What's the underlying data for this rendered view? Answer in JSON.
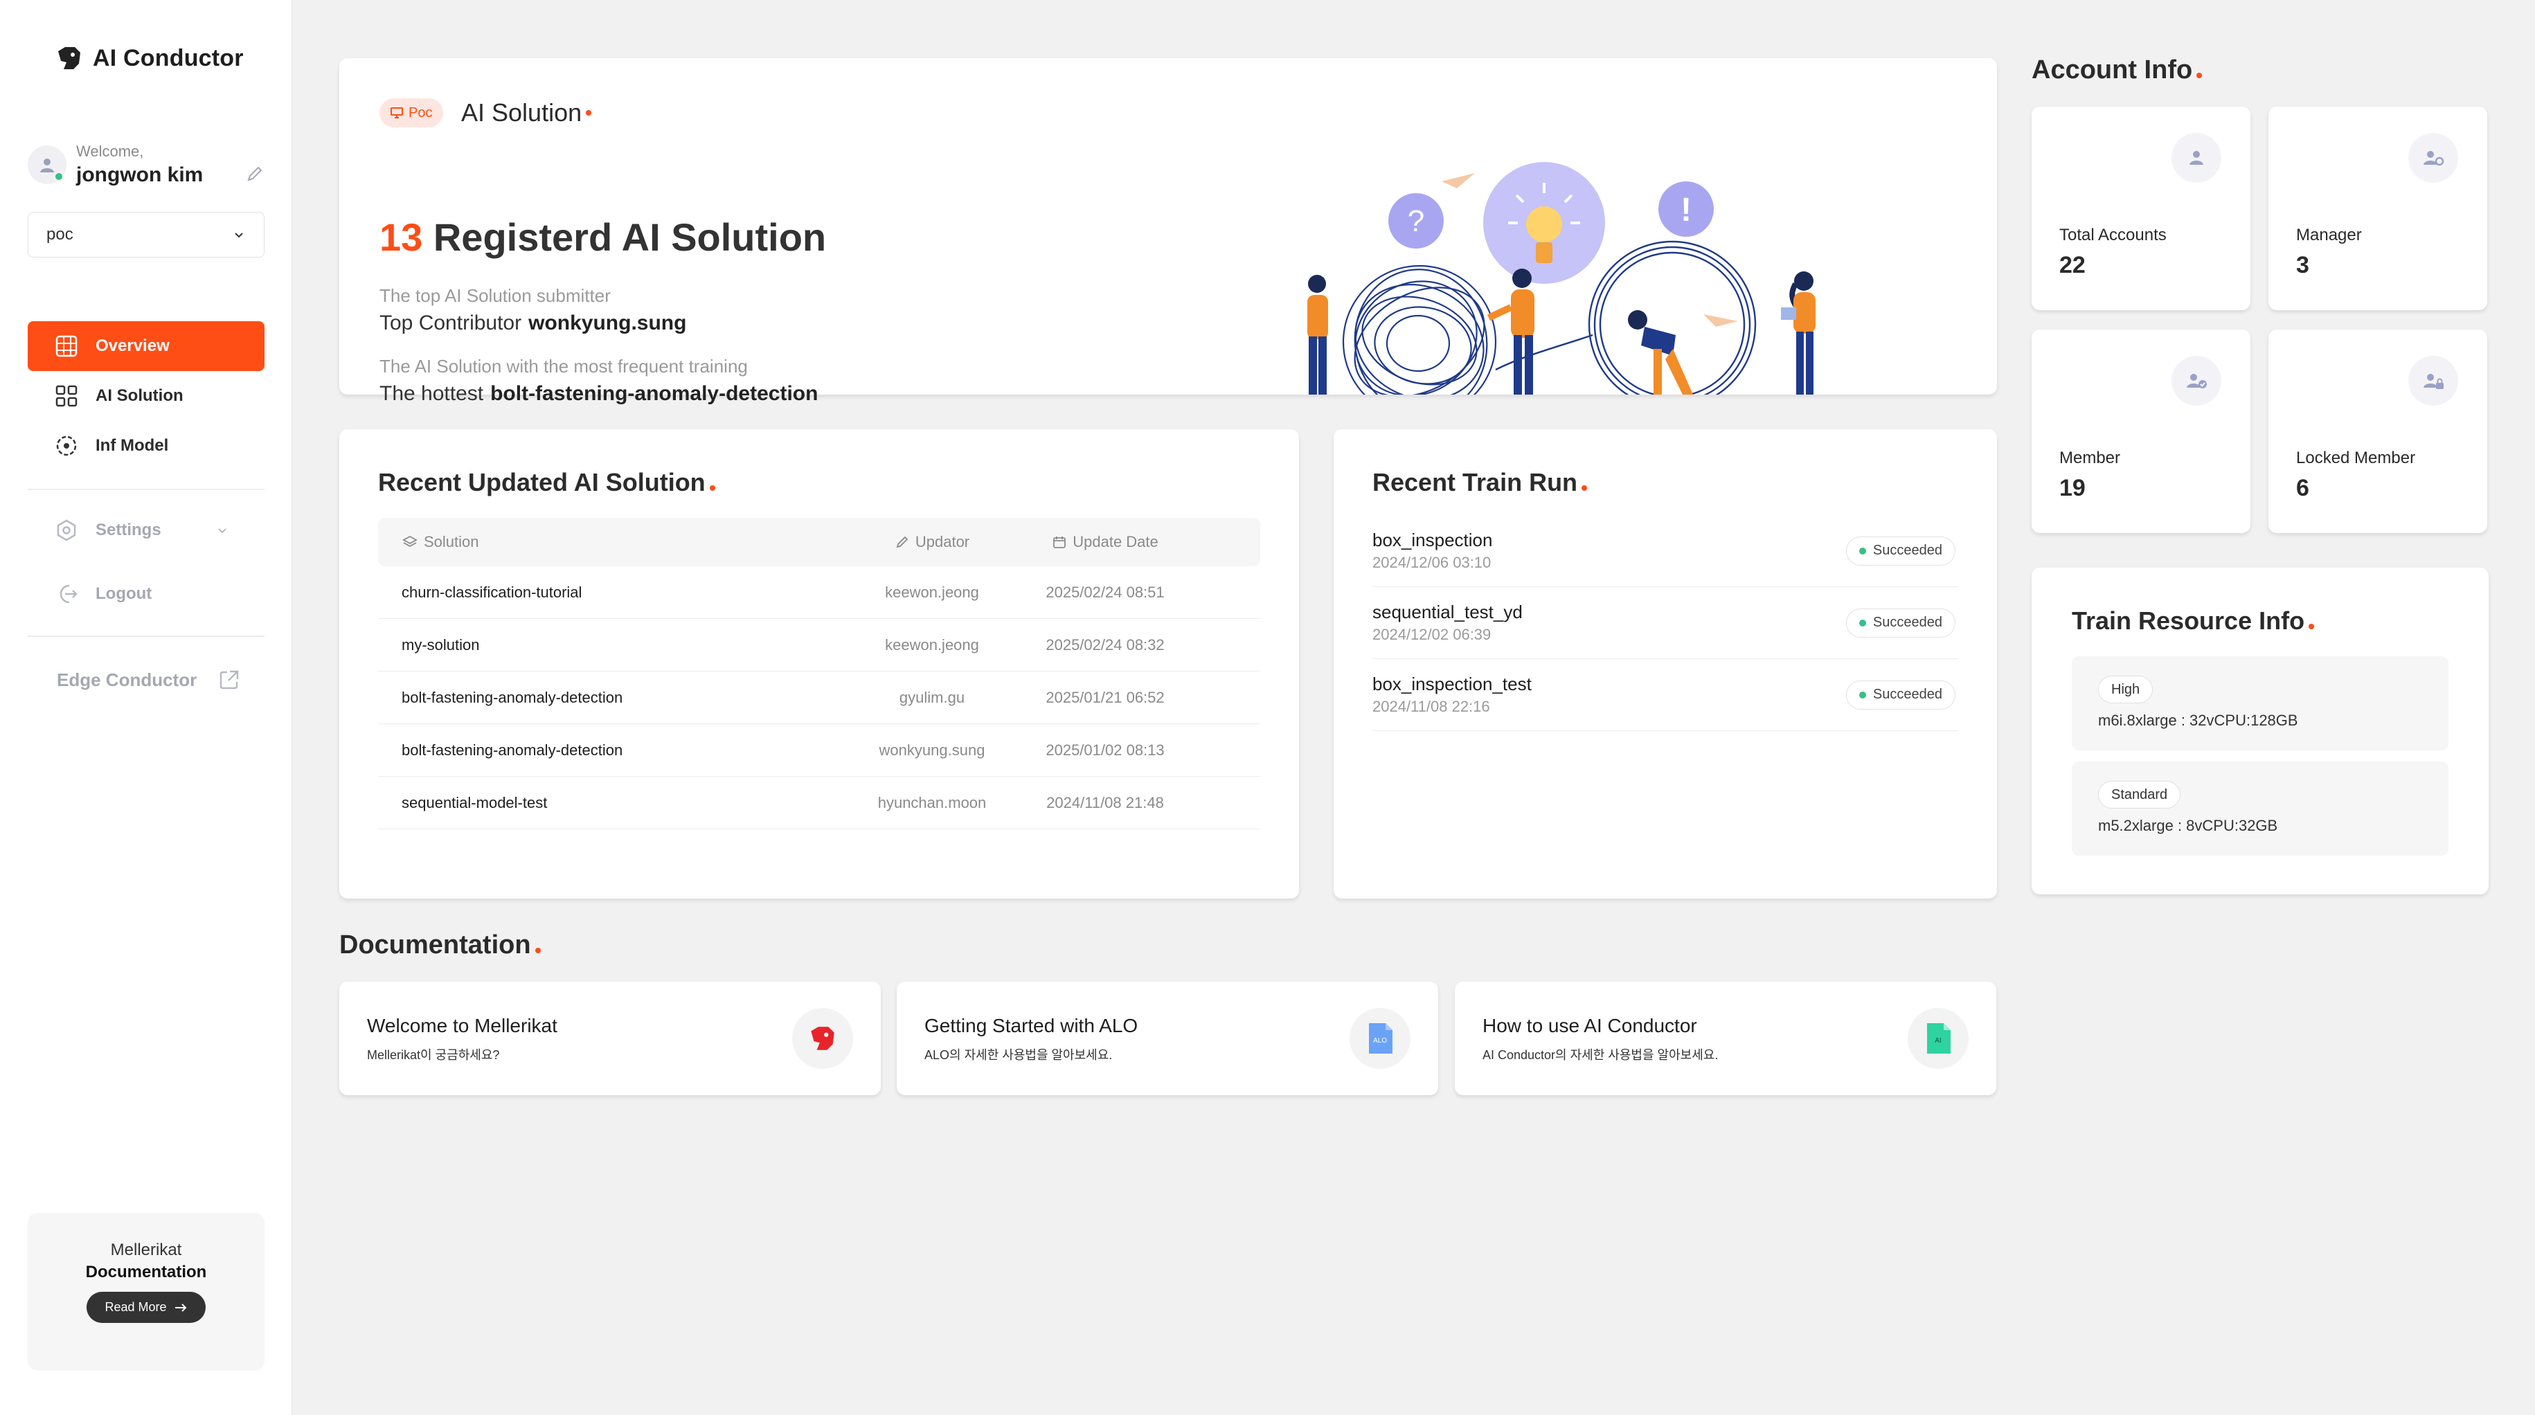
{
  "app": {
    "name": "AI Conductor"
  },
  "user": {
    "welcome": "Welcome,",
    "name": "jongwon kim"
  },
  "workspace": {
    "selected": "poc"
  },
  "nav": {
    "overview": "Overview",
    "ai_solution": "AI Solution",
    "inf_model": "Inf Model",
    "settings": "Settings",
    "logout": "Logout",
    "edge": "Edge Conductor"
  },
  "doc_promo": {
    "line1": "Mellerikat",
    "line2": "Documentation",
    "button": "Read More"
  },
  "hero": {
    "badge": "Poc",
    "label": "AI Solution",
    "count": "13",
    "heading": "Registerd AI Solution",
    "sub1": "The top AI Solution submitter",
    "val1_label": "Top Contributor",
    "val1": "wonkyung.sung",
    "sub2": "The AI Solution with the most frequent training",
    "val2_label": "The hottest",
    "val2": "bolt-fastening-anomaly-detection"
  },
  "recent": {
    "title": "Recent Updated AI Solution",
    "columns": {
      "solution": "Solution",
      "updator": "Updator",
      "date": "Update Date"
    },
    "rows": [
      {
        "solution": "churn-classification-tutorial",
        "updator": "keewon.jeong",
        "date": "2025/02/24 08:51"
      },
      {
        "solution": "my-solution",
        "updator": "keewon.jeong",
        "date": "2025/02/24 08:32"
      },
      {
        "solution": "bolt-fastening-anomaly-detection",
        "updator": "gyulim.gu",
        "date": "2025/01/21 06:52"
      },
      {
        "solution": "bolt-fastening-anomaly-detection",
        "updator": "wonkyung.sung",
        "date": "2025/01/02 08:13"
      },
      {
        "solution": "sequential-model-test",
        "updator": "hyunchan.moon",
        "date": "2024/11/08 21:48"
      }
    ]
  },
  "train": {
    "title": "Recent Train Run",
    "runs": [
      {
        "name": "box_inspection",
        "date": "2024/12/06 03:10",
        "status": "Succeeded"
      },
      {
        "name": "sequential_test_yd",
        "date": "2024/12/02 06:39",
        "status": "Succeeded"
      },
      {
        "name": "box_inspection_test",
        "date": "2024/11/08 22:16",
        "status": "Succeeded"
      }
    ]
  },
  "account": {
    "title": "Account Info",
    "total": {
      "label": "Total Accounts",
      "value": "22"
    },
    "manager": {
      "label": "Manager",
      "value": "3"
    },
    "member": {
      "label": "Member",
      "value": "19"
    },
    "locked": {
      "label": "Locked Member",
      "value": "6"
    }
  },
  "resource": {
    "title": "Train Resource Info",
    "items": [
      {
        "tier": "High",
        "spec": "m6i.8xlarge : 32vCPU:128GB"
      },
      {
        "tier": "Standard",
        "spec": "m5.2xlarge : 8vCPU:32GB"
      }
    ]
  },
  "docs": {
    "title": "Documentation",
    "cards": [
      {
        "title": "Welcome to Mellerikat",
        "sub": "Mellerikat이 궁금하세요?"
      },
      {
        "title": "Getting Started with ALO",
        "sub": "ALO의 자세한 사용법을 알아보세요.",
        "icon_text": "ALO"
      },
      {
        "title": "How to use AI Conductor",
        "sub": "AI Conductor의 자세한 사용법을 알아보세요.",
        "icon_text": "AI"
      }
    ]
  },
  "colors": {
    "accent": "#ff4d16",
    "success": "#36c08a",
    "illustration": "#1f3a8a",
    "figure": "#f28c28"
  },
  "illustration_marks": {
    "question": "?",
    "exclaim": "!"
  }
}
